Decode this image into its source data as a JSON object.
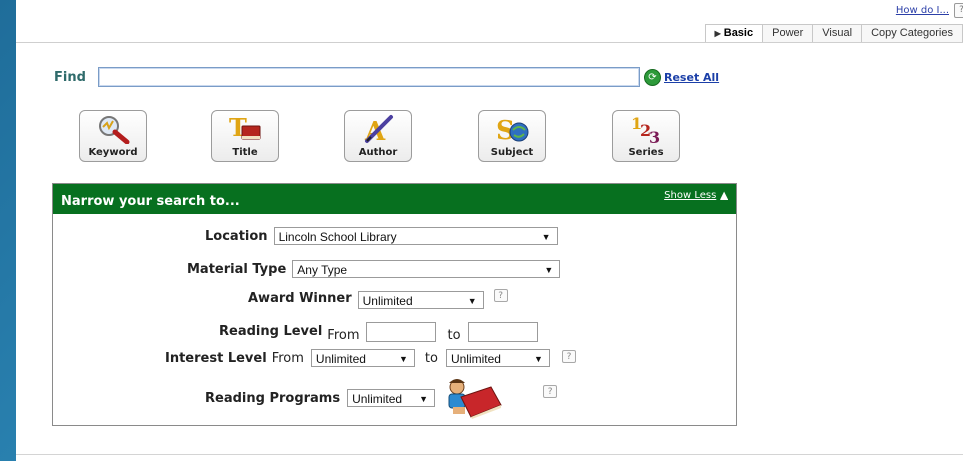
{
  "header": {
    "help_link": "How do I...",
    "help_q": "?",
    "tabs": [
      {
        "label": "Basic",
        "active": true
      },
      {
        "label": "Power",
        "active": false
      },
      {
        "label": "Visual",
        "active": false
      },
      {
        "label": "Copy Categories",
        "active": false
      }
    ]
  },
  "find": {
    "label": "Find",
    "value": "",
    "reset_label": "Reset All"
  },
  "search_buttons": [
    {
      "label": "Keyword",
      "icon": "magnifier-icon"
    },
    {
      "label": "Title",
      "icon": "title-book-icon"
    },
    {
      "label": "Author",
      "icon": "quill-pen-icon"
    },
    {
      "label": "Subject",
      "icon": "subject-icon"
    },
    {
      "label": "Series",
      "icon": "series-123-icon"
    }
  ],
  "narrow": {
    "title": "Narrow your search to...",
    "show_less": "Show Less",
    "location": {
      "label": "Location",
      "value": "Lincoln School Library"
    },
    "material_type": {
      "label": "Material Type",
      "value": "Any Type"
    },
    "award_winner": {
      "label": "Award Winner",
      "value": "Unlimited",
      "help": "?"
    },
    "reading_level": {
      "label": "Reading Level",
      "from": "From",
      "to": "to",
      "from_value": "",
      "to_value": ""
    },
    "interest_level": {
      "label": "Interest Level",
      "from": "From",
      "to": "to",
      "from_value": "Unlimited",
      "to_value": "Unlimited",
      "help": "?"
    },
    "reading_programs": {
      "label": "Reading Programs",
      "value": "Unlimited",
      "help": "?"
    }
  },
  "colors": {
    "header_green": "#07701f",
    "link_blue": "#1b3fa8",
    "find_label": "#2f6b6b"
  }
}
